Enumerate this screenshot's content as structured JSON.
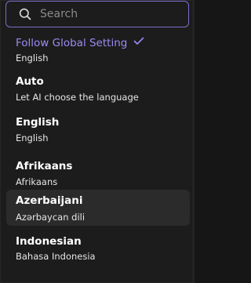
{
  "search": {
    "placeholder": "Search",
    "value": ""
  },
  "options": [
    {
      "title": "Follow Global Setting",
      "subtitle": "English",
      "selected": true
    },
    {
      "title": "Auto",
      "subtitle": "Let AI choose the language",
      "selected": false
    },
    {
      "title": "English",
      "subtitle": "English",
      "selected": false
    },
    {
      "title": "Afrikaans",
      "subtitle": "Afrikaans",
      "selected": false
    },
    {
      "title": "Azerbaijani",
      "subtitle": "Azərbaycan dili",
      "selected": false,
      "hovered": true
    },
    {
      "title": "Indonesian",
      "subtitle": "Bahasa Indonesia",
      "selected": false
    }
  ],
  "colors": {
    "accent": "#9c8cf2",
    "border_focus": "#7d6cc9",
    "background": "#1c1c1c",
    "hover": "#2b2b2b"
  },
  "icons": {
    "search": "search-icon",
    "check": "check-icon"
  }
}
